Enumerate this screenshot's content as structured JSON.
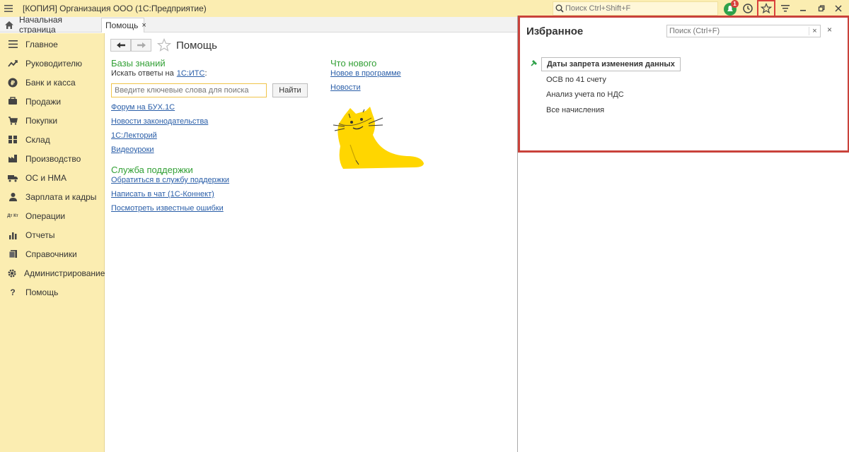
{
  "window": {
    "title": "[КОПИЯ] Организация ООО  (1С:Предприятие)"
  },
  "topbar": {
    "search_placeholder": "Поиск Ctrl+Shift+F",
    "notifications_count": "1",
    "icons": [
      "menu-icon",
      "search-icon",
      "notifications-icon",
      "history-icon",
      "star-icon",
      "settings-icon",
      "minimize-icon",
      "restore-icon",
      "close-icon"
    ]
  },
  "tabs": {
    "home_label": "Начальная страница",
    "active_label": "Помощь",
    "active_close": "×"
  },
  "sidebar": {
    "items": [
      {
        "label": "Главное",
        "icon": "menu-icon"
      },
      {
        "label": "Руководителю",
        "icon": "trend-icon"
      },
      {
        "label": "Банк и касса",
        "icon": "ruble-icon"
      },
      {
        "label": "Продажи",
        "icon": "cart-icon"
      },
      {
        "label": "Покупки",
        "icon": "basket-icon"
      },
      {
        "label": "Склад",
        "icon": "warehouse-icon"
      },
      {
        "label": "Производство",
        "icon": "factory-icon"
      },
      {
        "label": "ОС и НМА",
        "icon": "truck-icon"
      },
      {
        "label": "Зарплата и кадры",
        "icon": "person-icon"
      },
      {
        "label": "Операции",
        "icon": "dt-kt-icon"
      },
      {
        "label": "Отчеты",
        "icon": "chart-icon"
      },
      {
        "label": "Справочники",
        "icon": "book-icon"
      },
      {
        "label": "Администрирование",
        "icon": "gear-icon"
      },
      {
        "label": "Помощь",
        "icon": "question-icon"
      }
    ],
    "dt_kt_text": "Дт Кт"
  },
  "help_page": {
    "title": "Помощь",
    "knowledge": {
      "heading": "Базы знаний",
      "search_prompt": "Искать ответы на",
      "its_link": "1С:ИТС",
      "colon": ":",
      "search_placeholder": "Введите ключевые слова для поиска",
      "find_button": "Найти",
      "links": [
        "Форум на БУХ.1С",
        "Новости законодательства",
        "1С:Лекторий",
        "Видеоуроки"
      ]
    },
    "support": {
      "heading": "Служба поддержки",
      "links": [
        "Обратиться в службу поддержки",
        "Написать в чат (1С-Коннект)",
        "Посмотреть известные ошибки"
      ]
    },
    "whats_new": {
      "heading": "Что нового",
      "links": [
        "Новое в программе",
        "Новости"
      ]
    }
  },
  "favorites": {
    "title": "Избранное",
    "search_placeholder": "Поиск (Ctrl+F)",
    "search_clear": "×",
    "close": "×",
    "items": [
      "Даты запрета изменения данных",
      "ОСВ по 41 счету",
      "Анализ учета по НДС",
      "Все начисления"
    ]
  },
  "colors": {
    "accent_bar": "#fbedb1",
    "heading_green": "#32a035",
    "link_blue": "#2a5ea8",
    "highlight_red": "#c9423b"
  }
}
